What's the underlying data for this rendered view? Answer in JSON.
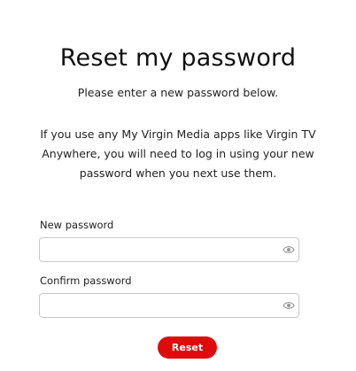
{
  "title": "Reset my password",
  "intro": "Please enter a new password below.",
  "info": "If you use any My Virgin Media apps like Virgin TV Anywhere, you will need to log in using your new password when you next use them.",
  "form": {
    "new_password": {
      "label": "New password",
      "value": "",
      "toggle_icon": "eye-icon"
    },
    "confirm_password": {
      "label": "Confirm password",
      "value": "",
      "toggle_icon": "eye-icon"
    },
    "submit_label": "Reset"
  },
  "colors": {
    "accent": "#e10a0a",
    "field_border": "#c9c9c9",
    "text": "#111111"
  }
}
